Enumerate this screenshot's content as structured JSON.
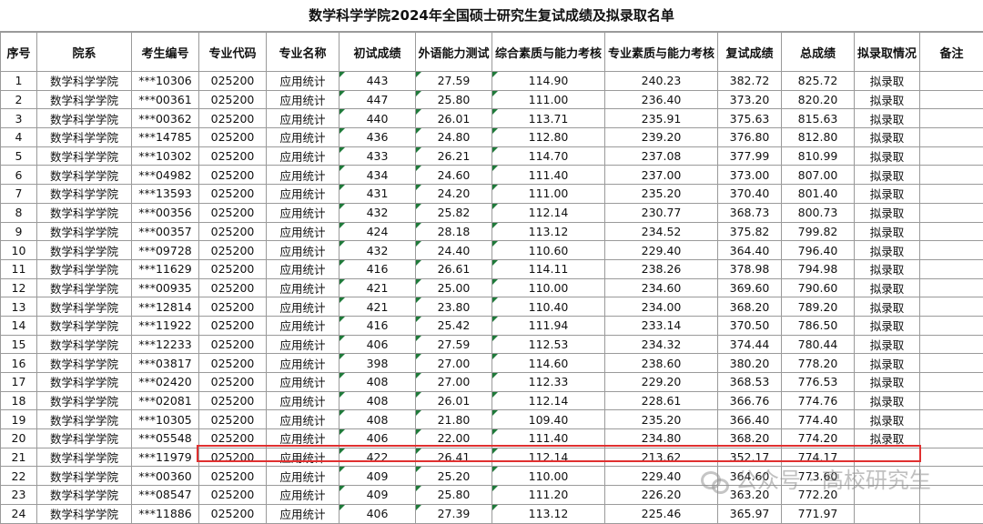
{
  "title": "数学科学学院2024年全国硕士研究生复试成绩及拟录取名单",
  "headers": [
    "序号",
    "院系",
    "考生编号",
    "专业代码",
    "专业名称",
    "初试成绩",
    "外语能力测试",
    "综合素质与能力考核",
    "专业素质与能力考核",
    "复试成绩",
    "总成绩",
    "拟录取情况",
    "备注"
  ],
  "rows": [
    [
      "1",
      "数学科学学院",
      "***10306",
      "025200",
      "应用统计",
      "443",
      "27.59",
      "114.90",
      "240.23",
      "382.72",
      "825.72",
      "拟录取",
      ""
    ],
    [
      "2",
      "数学科学学院",
      "***00361",
      "025200",
      "应用统计",
      "447",
      "25.80",
      "111.00",
      "236.40",
      "373.20",
      "820.20",
      "拟录取",
      ""
    ],
    [
      "3",
      "数学科学学院",
      "***00362",
      "025200",
      "应用统计",
      "440",
      "26.01",
      "113.71",
      "235.91",
      "375.63",
      "815.63",
      "拟录取",
      ""
    ],
    [
      "4",
      "数学科学学院",
      "***14785",
      "025200",
      "应用统计",
      "436",
      "24.80",
      "112.80",
      "239.20",
      "376.80",
      "812.80",
      "拟录取",
      ""
    ],
    [
      "5",
      "数学科学学院",
      "***10302",
      "025200",
      "应用统计",
      "433",
      "26.21",
      "114.70",
      "237.08",
      "377.99",
      "810.99",
      "拟录取",
      ""
    ],
    [
      "6",
      "数学科学学院",
      "***04982",
      "025200",
      "应用统计",
      "434",
      "24.60",
      "111.40",
      "237.00",
      "373.00",
      "807.00",
      "拟录取",
      ""
    ],
    [
      "7",
      "数学科学学院",
      "***13593",
      "025200",
      "应用统计",
      "431",
      "24.20",
      "111.00",
      "235.20",
      "370.40",
      "801.40",
      "拟录取",
      ""
    ],
    [
      "8",
      "数学科学学院",
      "***00356",
      "025200",
      "应用统计",
      "432",
      "25.82",
      "112.14",
      "230.77",
      "368.73",
      "800.73",
      "拟录取",
      ""
    ],
    [
      "9",
      "数学科学学院",
      "***00357",
      "025200",
      "应用统计",
      "424",
      "28.18",
      "113.12",
      "234.52",
      "375.82",
      "799.82",
      "拟录取",
      ""
    ],
    [
      "10",
      "数学科学学院",
      "***09728",
      "025200",
      "应用统计",
      "432",
      "24.40",
      "110.60",
      "229.40",
      "364.40",
      "796.40",
      "拟录取",
      ""
    ],
    [
      "11",
      "数学科学学院",
      "***11629",
      "025200",
      "应用统计",
      "416",
      "26.61",
      "114.11",
      "238.26",
      "378.98",
      "794.98",
      "拟录取",
      ""
    ],
    [
      "12",
      "数学科学学院",
      "***00935",
      "025200",
      "应用统计",
      "421",
      "25.00",
      "110.00",
      "234.60",
      "369.60",
      "790.60",
      "拟录取",
      ""
    ],
    [
      "13",
      "数学科学学院",
      "***12814",
      "025200",
      "应用统计",
      "421",
      "23.80",
      "110.40",
      "234.00",
      "368.20",
      "789.20",
      "拟录取",
      ""
    ],
    [
      "14",
      "数学科学学院",
      "***11922",
      "025200",
      "应用统计",
      "416",
      "25.42",
      "111.94",
      "233.14",
      "370.50",
      "786.50",
      "拟录取",
      ""
    ],
    [
      "15",
      "数学科学学院",
      "***12233",
      "025200",
      "应用统计",
      "406",
      "27.59",
      "112.53",
      "234.32",
      "374.44",
      "780.44",
      "拟录取",
      ""
    ],
    [
      "16",
      "数学科学学院",
      "***03817",
      "025200",
      "应用统计",
      "398",
      "27.00",
      "114.60",
      "238.60",
      "380.20",
      "778.20",
      "拟录取",
      ""
    ],
    [
      "17",
      "数学科学学院",
      "***02420",
      "025200",
      "应用统计",
      "408",
      "27.00",
      "112.33",
      "229.20",
      "368.53",
      "776.53",
      "拟录取",
      ""
    ],
    [
      "18",
      "数学科学学院",
      "***02081",
      "025200",
      "应用统计",
      "408",
      "26.01",
      "112.14",
      "228.61",
      "366.76",
      "774.76",
      "拟录取",
      ""
    ],
    [
      "19",
      "数学科学学院",
      "***10305",
      "025200",
      "应用统计",
      "408",
      "21.80",
      "109.40",
      "235.20",
      "366.40",
      "774.40",
      "拟录取",
      ""
    ],
    [
      "20",
      "数学科学学院",
      "***05548",
      "025200",
      "应用统计",
      "406",
      "22.00",
      "111.40",
      "234.80",
      "368.20",
      "774.20",
      "拟录取",
      ""
    ],
    [
      "21",
      "数学科学学院",
      "***11979",
      "025200",
      "应用统计",
      "422",
      "26.41",
      "112.14",
      "213.62",
      "352.17",
      "774.17",
      "",
      ""
    ],
    [
      "22",
      "数学科学学院",
      "***00360",
      "025200",
      "应用统计",
      "409",
      "25.20",
      "110.00",
      "229.40",
      "364.60",
      "773.60",
      "",
      ""
    ],
    [
      "23",
      "数学科学学院",
      "***08547",
      "025200",
      "应用统计",
      "409",
      "25.80",
      "111.20",
      "226.20",
      "363.20",
      "772.20",
      "",
      ""
    ],
    [
      "24",
      "数学科学学院",
      "***11886",
      "025200",
      "应用统计",
      "406",
      "27.39",
      "113.12",
      "225.46",
      "365.97",
      "771.97",
      "",
      ""
    ]
  ],
  "watermark": "公众号 · 高校研究生",
  "colors": {
    "grid": "#9a9a9a",
    "highlight": "#e03030",
    "cell_marker": "#1f7a3a"
  }
}
